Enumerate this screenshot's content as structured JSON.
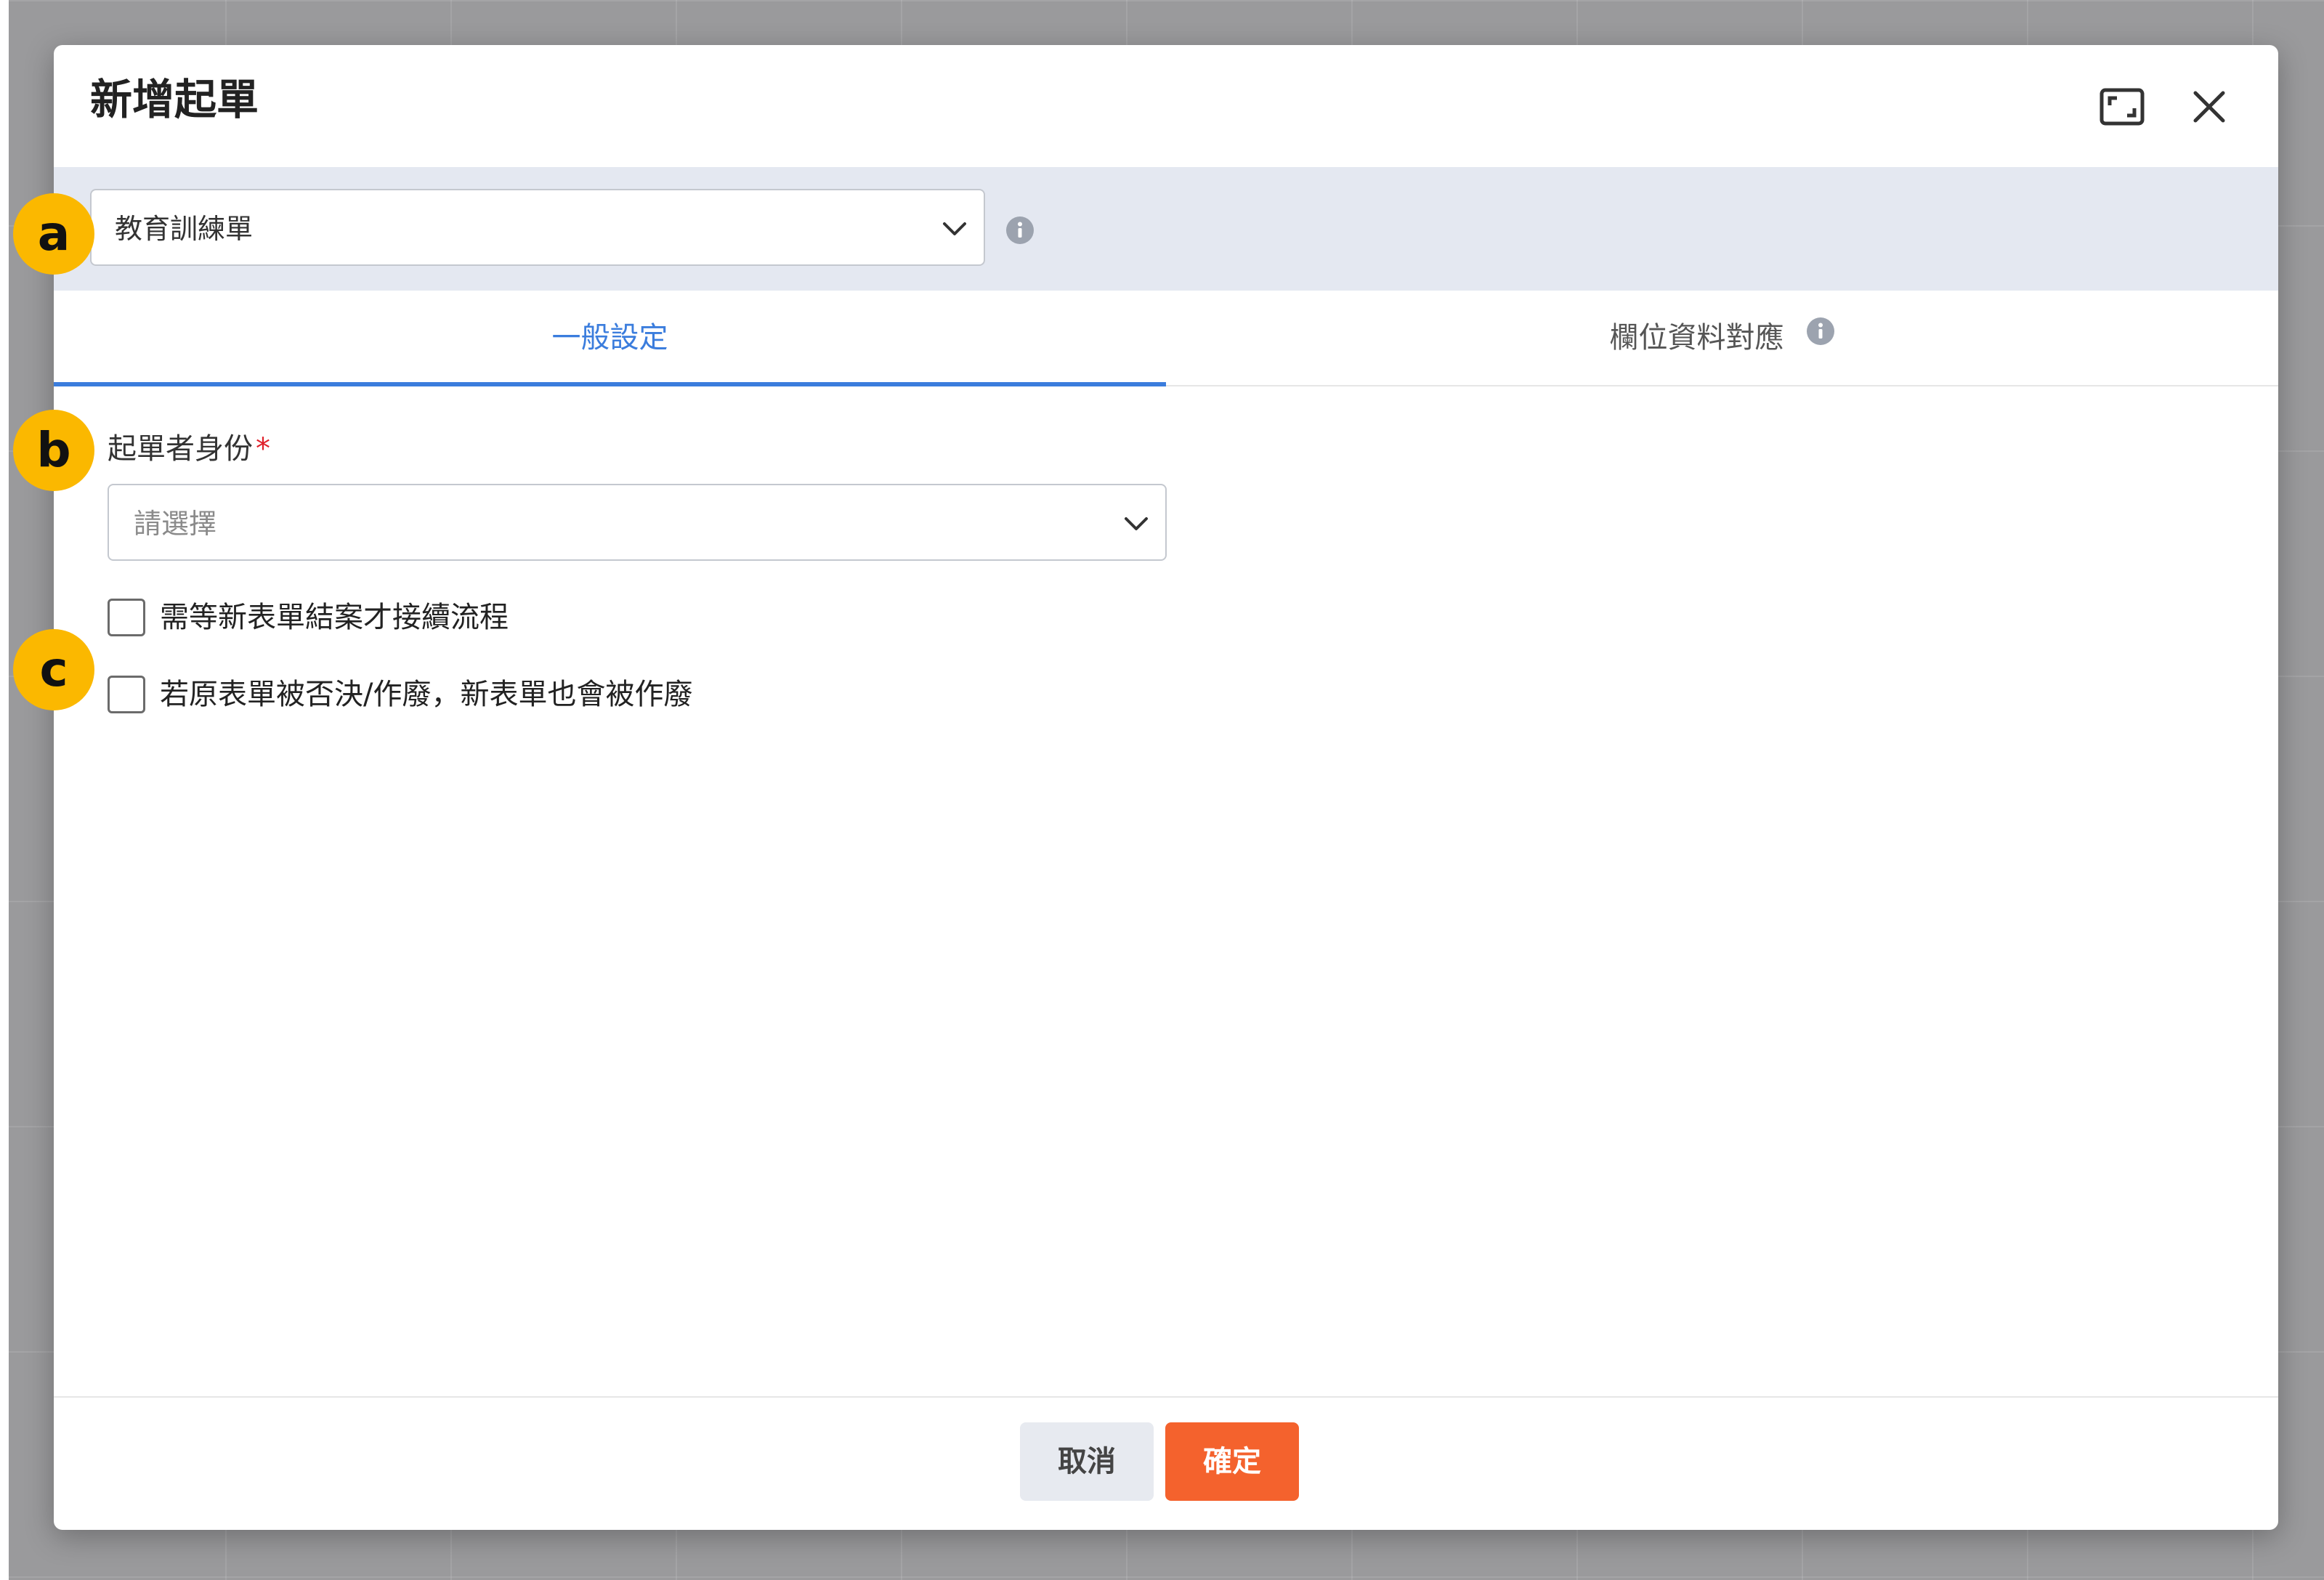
{
  "dialog": {
    "title": "新增起單",
    "icons": {
      "maximize": "maximize-icon",
      "close": "close-icon"
    }
  },
  "form_type_select": {
    "value": "教育訓練單",
    "icon": "chevron-down-icon"
  },
  "tabs": [
    {
      "label": "一般設定",
      "active": true
    },
    {
      "label": "欄位資料對應",
      "active": false,
      "icon": "info-icon"
    }
  ],
  "initiator_role": {
    "label": "起單者身份",
    "required_mark": "*",
    "placeholder": "請選擇"
  },
  "options": [
    {
      "label": "需等新表單結案才接續流程",
      "checked": false
    },
    {
      "label": "若原表單被否決/作廢，新表單也會被作廢",
      "checked": false
    }
  ],
  "footer": {
    "cancel_label": "取消",
    "confirm_label": "確定"
  },
  "annotations": [
    "a",
    "b",
    "c"
  ],
  "colors": {
    "accent": "#3b7ddd",
    "confirm": "#f4622d",
    "badge": "#fbb800",
    "required": "#e0202a",
    "select_bar": "#e4e8f1"
  }
}
